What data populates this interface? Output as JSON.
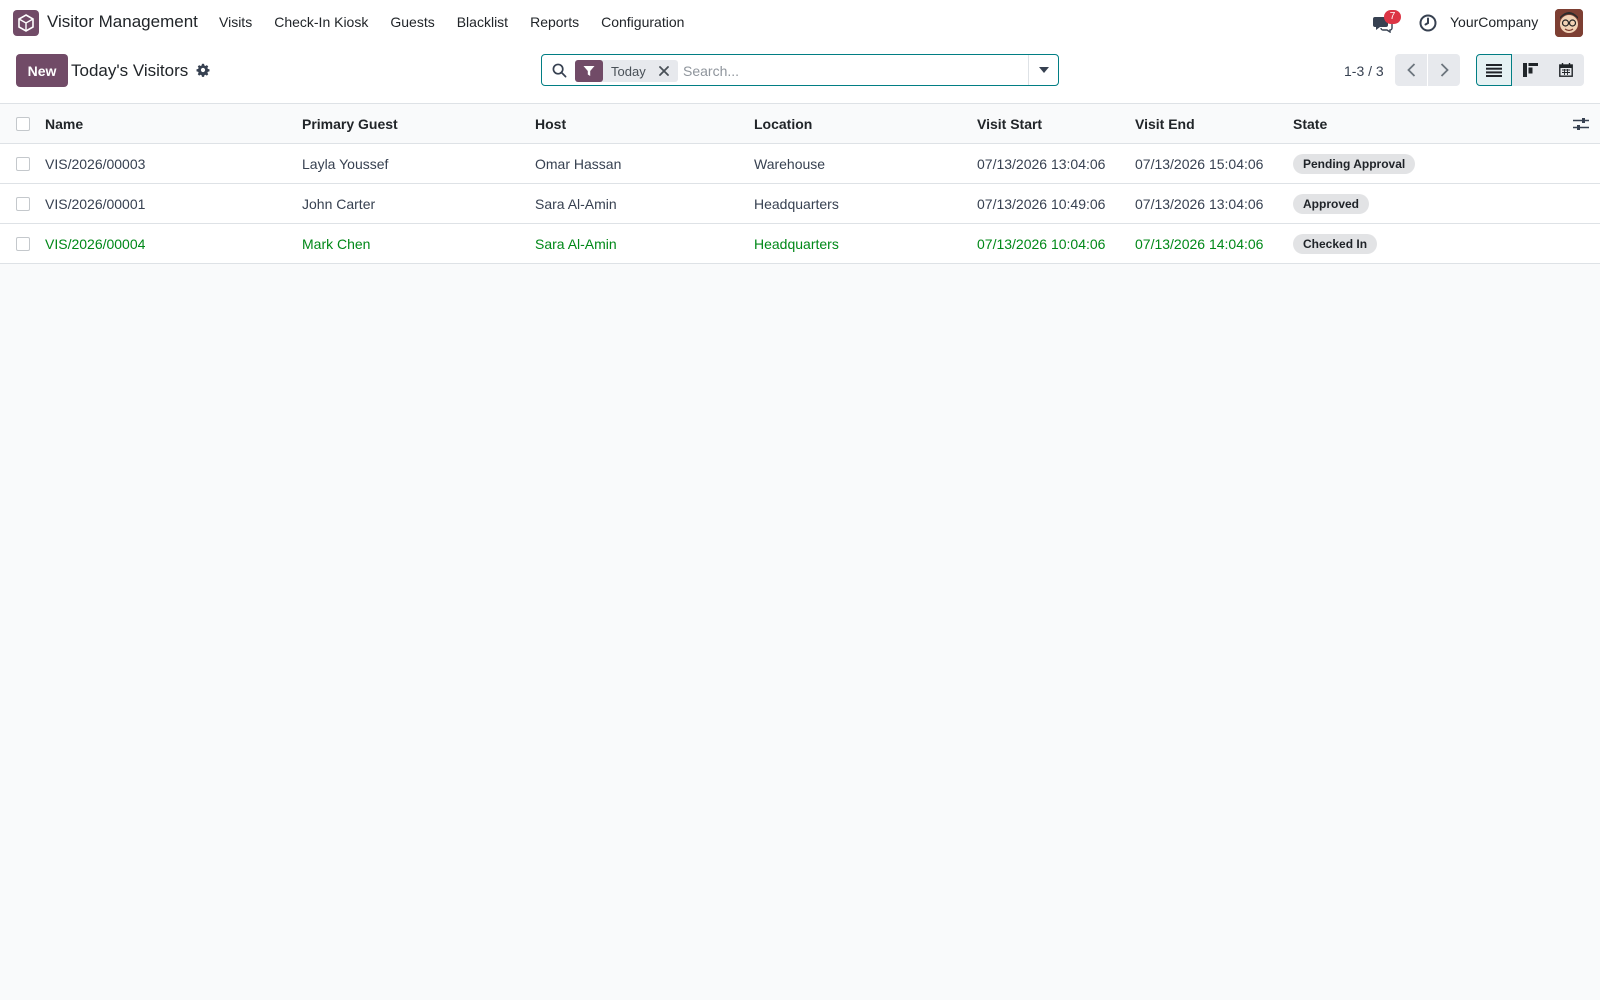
{
  "nav": {
    "app_name": "Visitor Management",
    "menu": [
      "Visits",
      "Check-In Kiosk",
      "Guests",
      "Blacklist",
      "Reports",
      "Configuration"
    ],
    "messages_count": "7",
    "company": "YourCompany"
  },
  "control": {
    "new_label": "New",
    "title": "Today's Visitors",
    "search": {
      "facet": "Today",
      "placeholder": "Search..."
    },
    "pager": "1-3 / 3"
  },
  "table": {
    "columns": [
      "Name",
      "Primary Guest",
      "Host",
      "Location",
      "Visit Start",
      "Visit End",
      "State"
    ],
    "rows": [
      {
        "name": "VIS/2026/00003",
        "guest": "Layla Youssef",
        "host": "Omar Hassan",
        "location": "Warehouse",
        "start": "07/13/2026 13:04:06",
        "end": "07/13/2026 15:04:06",
        "state": "Pending Approval"
      },
      {
        "name": "VIS/2026/00001",
        "guest": "John Carter",
        "host": "Sara Al-Amin",
        "location": "Headquarters",
        "start": "07/13/2026 10:49:06",
        "end": "07/13/2026 13:04:06",
        "state": "Approved"
      },
      {
        "name": "VIS/2026/00004",
        "guest": "Mark Chen",
        "host": "Sara Al-Amin",
        "location": "Headquarters",
        "start": "07/13/2026 10:04:06",
        "end": "07/13/2026 14:04:06",
        "state": "Checked In"
      }
    ]
  },
  "colors": {
    "brand": "#714b67",
    "accent": "#017e84",
    "checked_in_text": "#008818",
    "badge_red": "#dc3545"
  }
}
